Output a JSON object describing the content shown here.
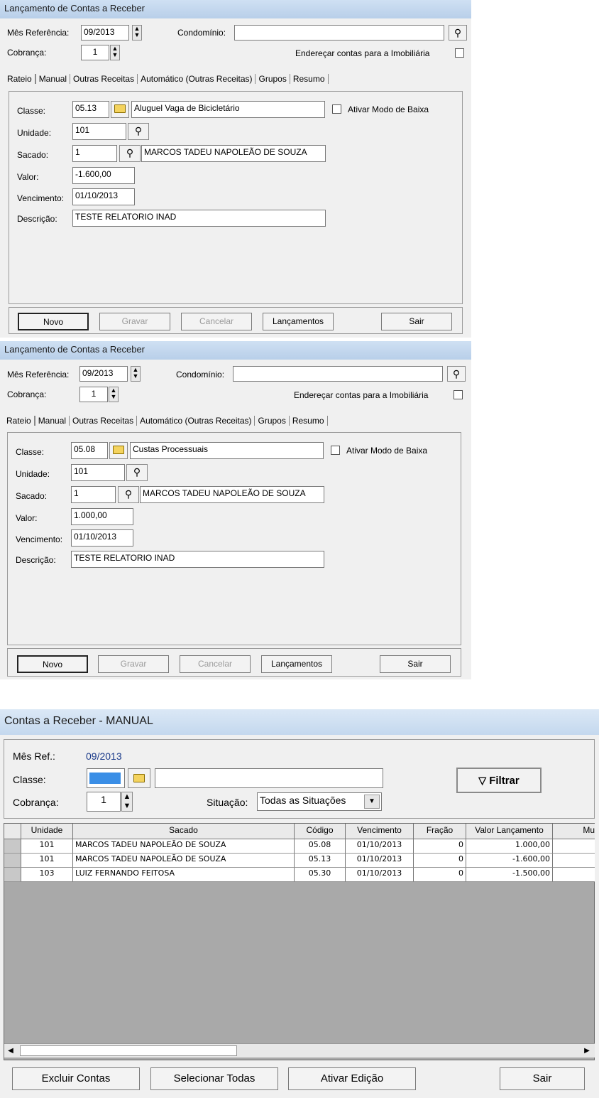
{
  "win1": {
    "title": "Lançamento de Contas a Receber",
    "mes_label": "Mês Referência:",
    "mes_value": "09/2013",
    "cond_label": "Condomínio:",
    "cobranca_label": "Cobrança:",
    "cobranca_value": "1",
    "enderecar_label": "Endereçar contas para a Imobiliária",
    "tabs": [
      "Rateio",
      "Manual",
      "Outras Receitas",
      "Automático (Outras Receitas)",
      "Grupos",
      "Resumo"
    ],
    "classe_label": "Classe:",
    "classe_code": "05.13",
    "classe_desc": "Aluguel Vaga de Bicicletário",
    "modo_baixa_label": "Ativar Modo de Baixa",
    "unidade_label": "Unidade:",
    "unidade_value": "101",
    "sacado_label": "Sacado:",
    "sacado_code": "1",
    "sacado_name": "MARCOS TADEU NAPOLEÃO DE SOUZA",
    "valor_label": "Valor:",
    "valor_value": "-1.600,00",
    "venc_label": "Vencimento:",
    "venc_value": "01/10/2013",
    "desc_label": "Descrição:",
    "desc_value": "TESTE RELATORIO INAD",
    "buttons": {
      "novo": "Novo",
      "gravar": "Gravar",
      "cancelar": "Cancelar",
      "lancamentos": "Lançamentos",
      "sair": "Sair"
    }
  },
  "win2": {
    "title": "Lançamento de Contas a Receber",
    "mes_label": "Mês Referência:",
    "mes_value": "09/2013",
    "cond_label": "Condomínio:",
    "cobranca_label": "Cobrança:",
    "cobranca_value": "1",
    "enderecar_label": "Endereçar contas para a Imobiliária",
    "tabs": [
      "Rateio",
      "Manual",
      "Outras Receitas",
      "Automático (Outras Receitas)",
      "Grupos",
      "Resumo"
    ],
    "classe_label": "Classe:",
    "classe_code": "05.08",
    "classe_desc": "Custas Processuais",
    "modo_baixa_label": "Ativar Modo de Baixa",
    "unidade_label": "Unidade:",
    "unidade_value": "101",
    "sacado_label": "Sacado:",
    "sacado_code": "1",
    "sacado_name": "MARCOS TADEU NAPOLEÃO DE SOUZA",
    "valor_label": "Valor:",
    "valor_value": "1.000,00",
    "venc_label": "Vencimento:",
    "venc_value": "01/10/2013",
    "desc_label": "Descrição:",
    "desc_value": "TESTE RELATORIO INAD",
    "buttons": {
      "novo": "Novo",
      "gravar": "Gravar",
      "cancelar": "Cancelar",
      "lancamentos": "Lançamentos",
      "sair": "Sair"
    }
  },
  "win3": {
    "title": "Contas a Receber - MANUAL",
    "mes_label": "Mês Ref.:",
    "mes_value": "09/2013",
    "classe_label": "Classe:",
    "cobranca_label": "Cobrança:",
    "cobranca_value": "1",
    "situacao_label": "Situação:",
    "situacao_value": "Todas as Situações",
    "filtrar": "Filtrar",
    "columns": [
      "Unidade",
      "Sacado",
      "Código",
      "Vencimento",
      "Fração",
      "Valor Lançamento",
      "Mu"
    ],
    "rows": [
      [
        "101",
        "MARCOS TADEU NAPOLEÃO DE SOUZA",
        "05.08",
        "01/10/2013",
        "0",
        "1.000,00"
      ],
      [
        "101",
        "MARCOS TADEU NAPOLEÃO DE SOUZA",
        "05.13",
        "01/10/2013",
        "0",
        "-1.600,00"
      ],
      [
        "103",
        "LUIZ FERNANDO FEITOSA",
        "05.30",
        "01/10/2013",
        "0",
        "-1.500,00"
      ]
    ],
    "buttons": {
      "excluir": "Excluir Contas",
      "selecionar": "Selecionar Todas",
      "ativar": "Ativar Edição",
      "sair": "Sair"
    }
  }
}
